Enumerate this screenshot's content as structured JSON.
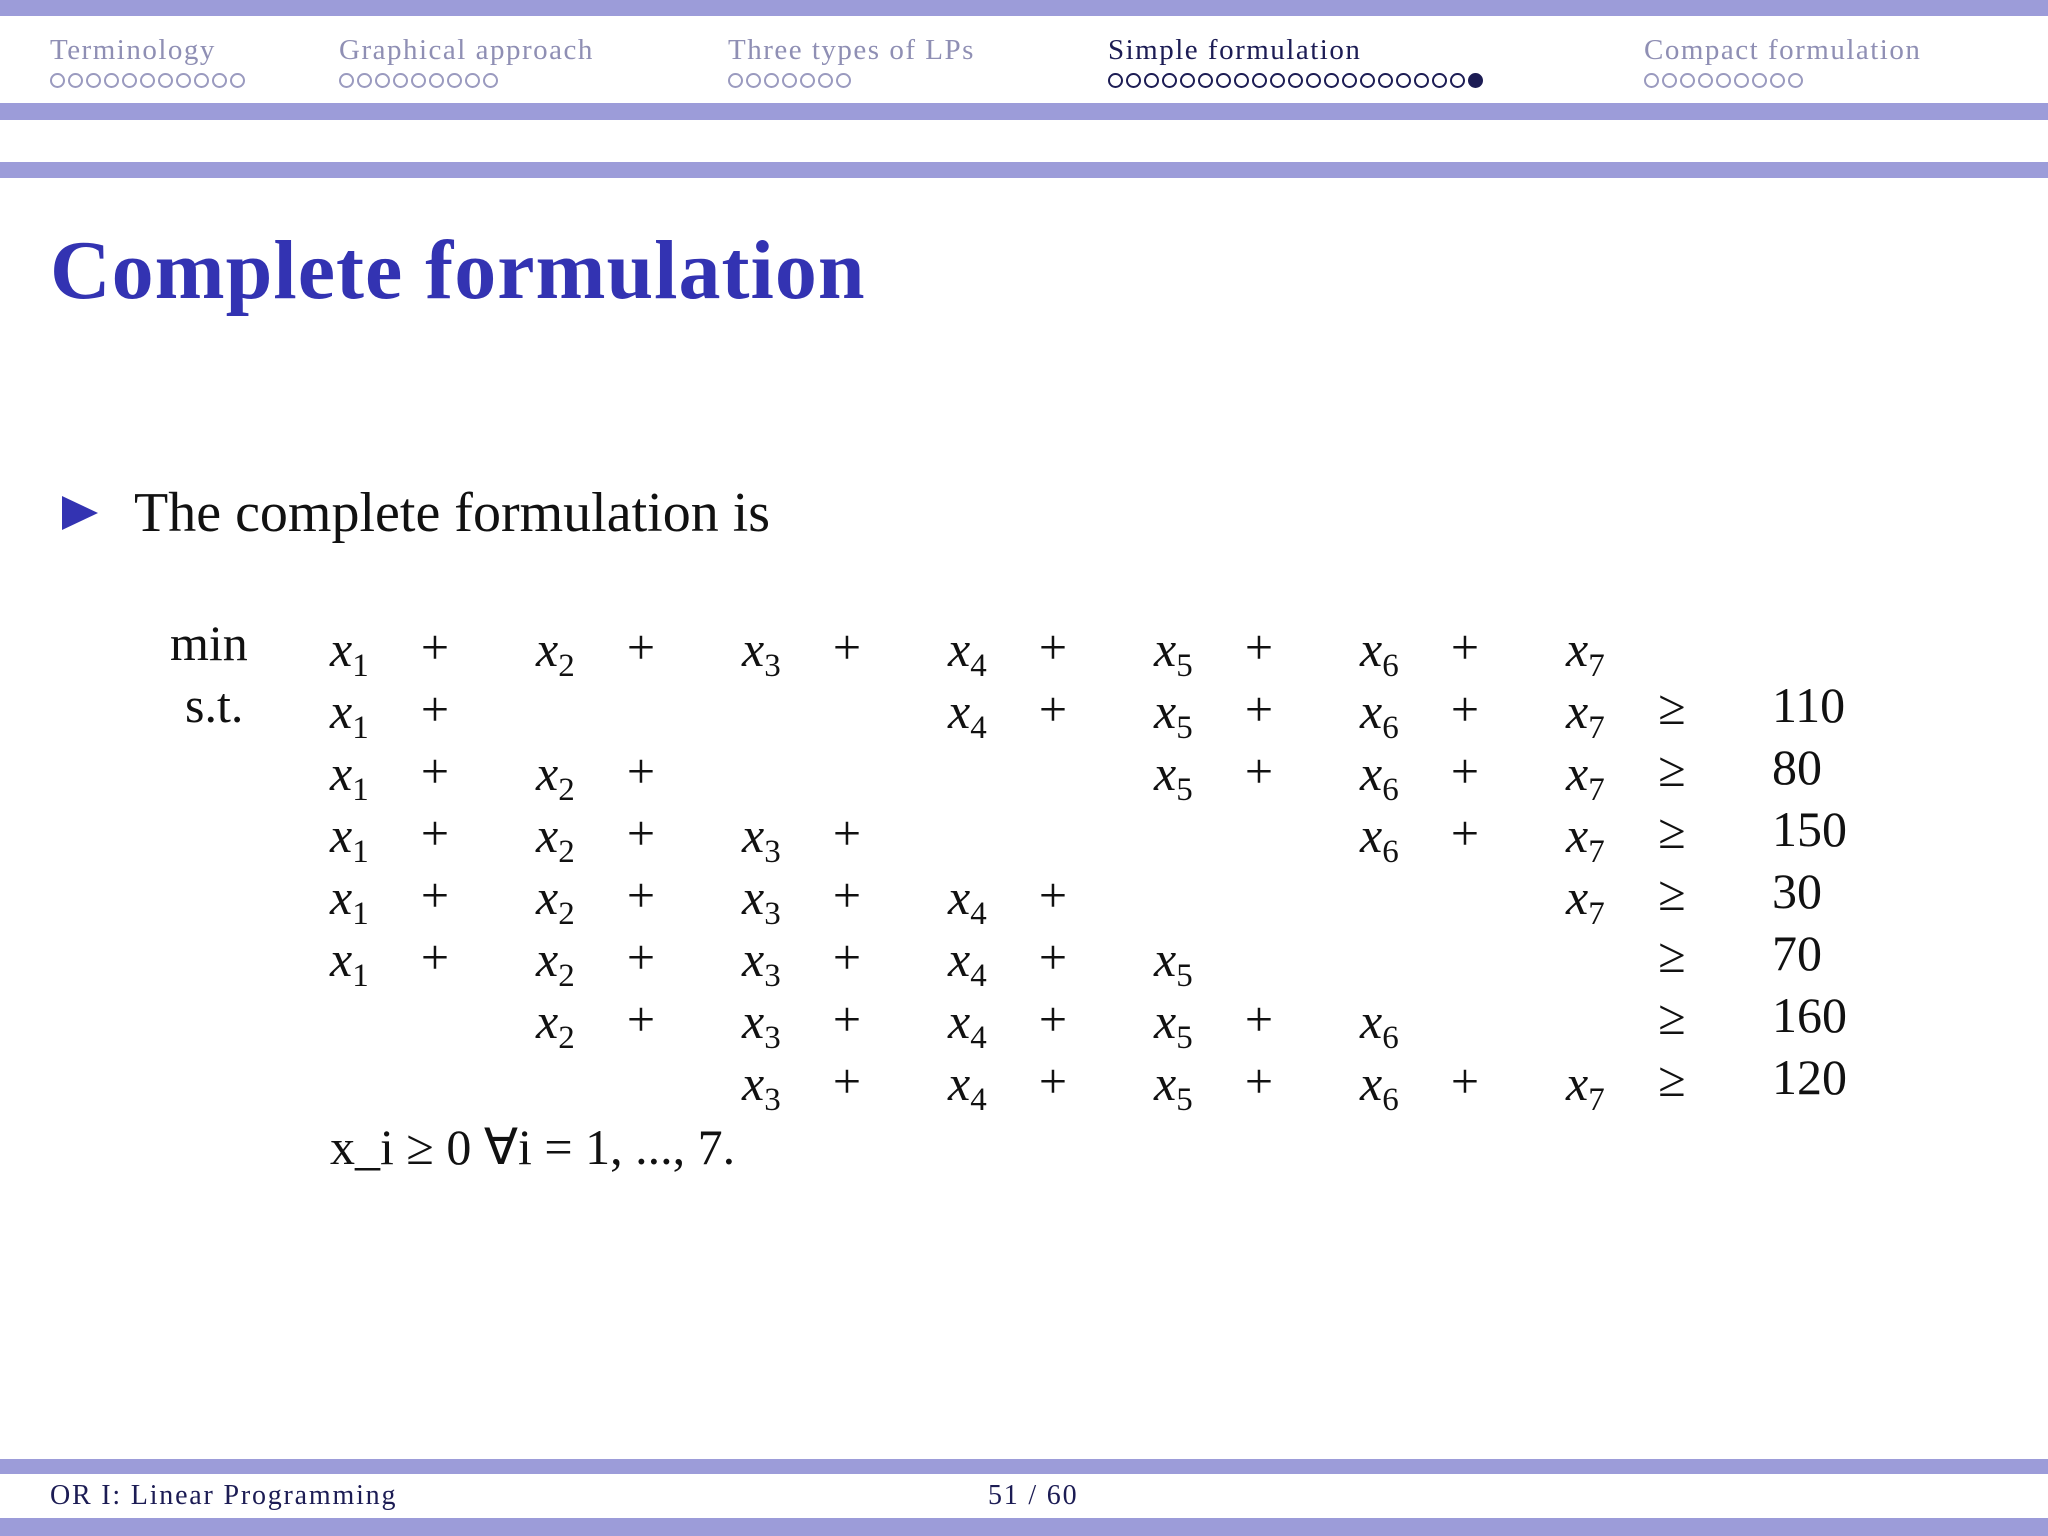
{
  "nav": {
    "sections": [
      {
        "label": "Terminology",
        "dots": 11,
        "active": false
      },
      {
        "label": "Graphical approach",
        "dots": 9,
        "active": false
      },
      {
        "label": "Three types of LPs",
        "dots": 7,
        "active": false
      },
      {
        "label": "Simple formulation",
        "dots": 21,
        "active": true,
        "current_dot": 21
      },
      {
        "label": "Compact formulation",
        "dots": 9,
        "active": false
      }
    ]
  },
  "slide": {
    "title": "Complete formulation",
    "bullet": "The complete formulation is"
  },
  "formulation": {
    "objective_keyword": "min",
    "constraint_keyword": "s.t.",
    "variables": [
      "x1",
      "x2",
      "x3",
      "x4",
      "x5",
      "x6",
      "x7"
    ],
    "objective_terms": [
      1,
      2,
      3,
      4,
      5,
      6,
      7
    ],
    "constraints": [
      {
        "terms": [
          1,
          4,
          5,
          6,
          7
        ],
        "relation": "≥",
        "rhs": "110"
      },
      {
        "terms": [
          1,
          2,
          5,
          6,
          7
        ],
        "relation": "≥",
        "rhs": "80"
      },
      {
        "terms": [
          1,
          2,
          3,
          6,
          7
        ],
        "relation": "≥",
        "rhs": "150"
      },
      {
        "terms": [
          1,
          2,
          3,
          4,
          7
        ],
        "relation": "≥",
        "rhs": "30"
      },
      {
        "terms": [
          1,
          2,
          3,
          4,
          5
        ],
        "relation": "≥",
        "rhs": "70"
      },
      {
        "terms": [
          2,
          3,
          4,
          5,
          6
        ],
        "relation": "≥",
        "rhs": "160"
      },
      {
        "terms": [
          3,
          4,
          5,
          6,
          7
        ],
        "relation": "≥",
        "rhs": "120"
      }
    ],
    "nonnegativity": "x_i ≥ 0   ∀i = 1, ..., 7."
  },
  "footer": {
    "course": "OR I: Linear Programming",
    "page": "51 / 60"
  },
  "colors": {
    "accent": "#3333b2",
    "bar": "#9c9cd9",
    "nav_inactive": "#8f8fb4",
    "nav_active": "#1c1c54"
  }
}
